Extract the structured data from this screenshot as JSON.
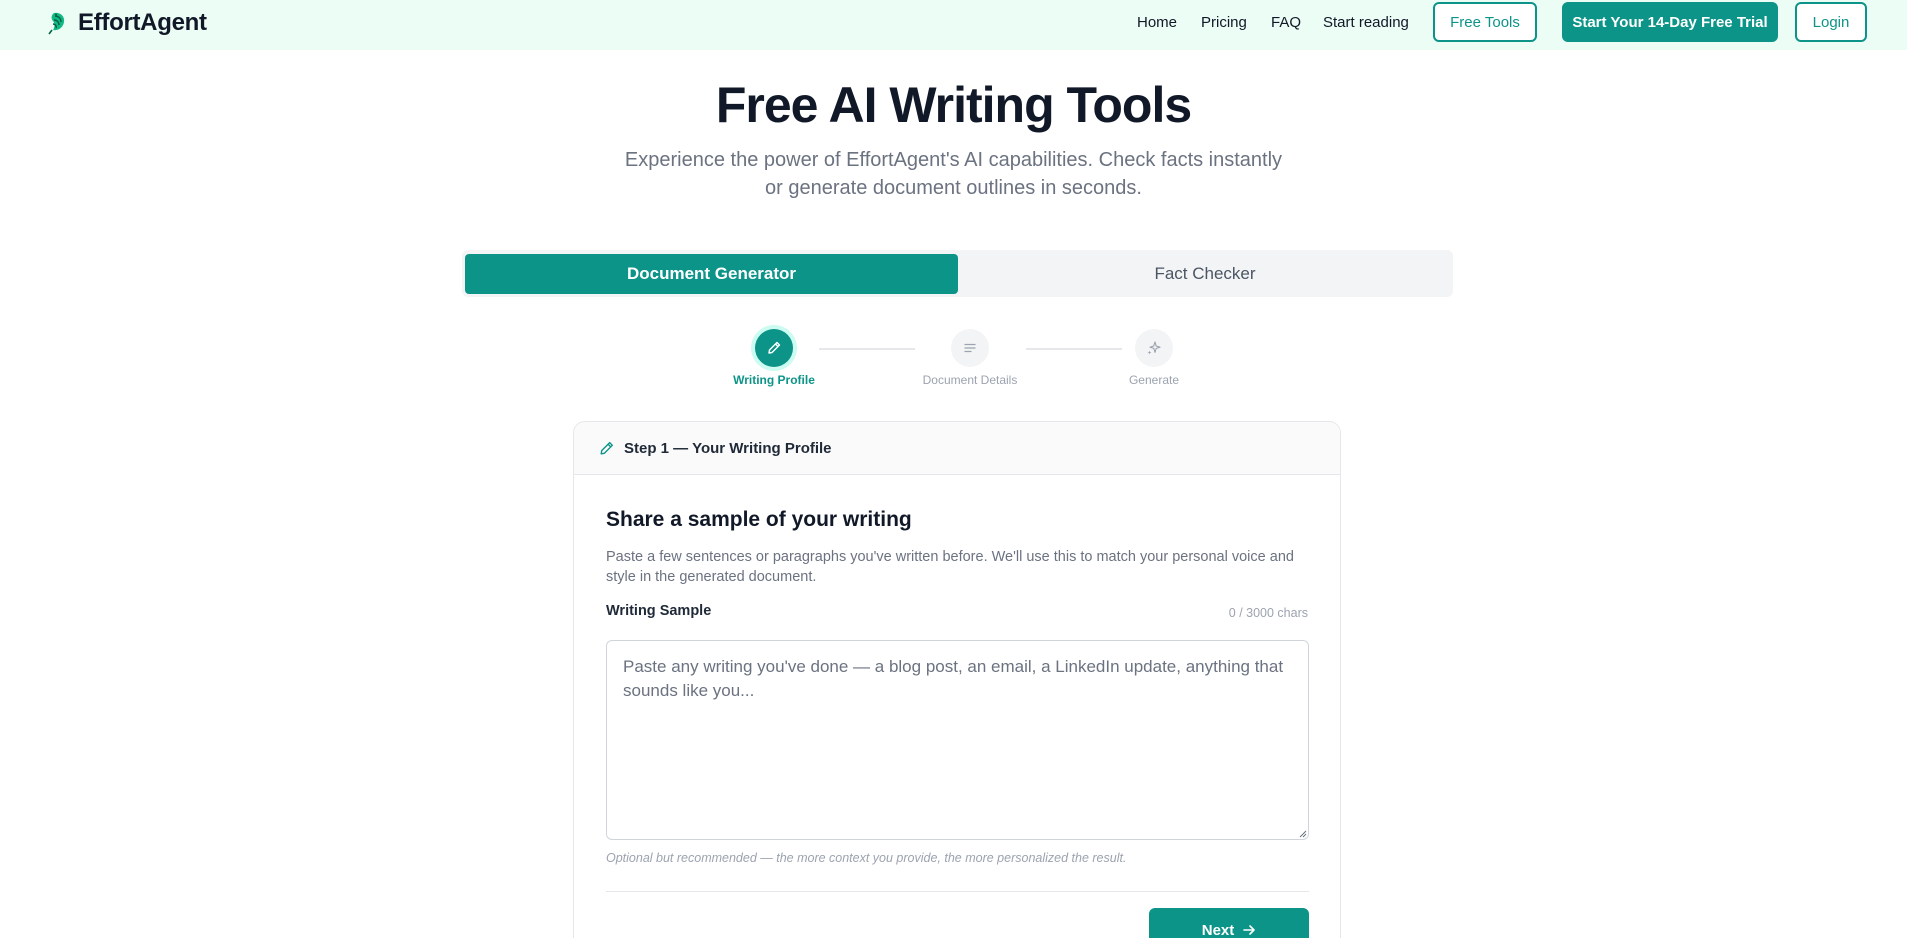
{
  "colors": {
    "accent": "#0d9488",
    "header_bg": "#ecfdf5",
    "muted": "#6b7280"
  },
  "header": {
    "brand": "EffortAgent",
    "logo_icon": "leaf-bird-icon",
    "nav": [
      "Home",
      "Pricing",
      "FAQ",
      "Start reading"
    ],
    "free_tools": "Free Tools",
    "trial": "Start Your 14-Day Free Trial",
    "login": "Login"
  },
  "hero": {
    "title": "Free AI Writing Tools",
    "subtitle": "Experience the power of EffortAgent's AI capabilities. Check facts instantly or generate document outlines in seconds."
  },
  "tabs": [
    {
      "label": "Document Generator",
      "active": true
    },
    {
      "label": "Fact Checker",
      "active": false
    }
  ],
  "steps": [
    {
      "label": "Writing Profile",
      "icon": "pencil-icon",
      "active": true
    },
    {
      "label": "Document Details",
      "icon": "lines-icon",
      "active": false
    },
    {
      "label": "Generate",
      "icon": "sparkles-icon",
      "active": false
    }
  ],
  "card": {
    "header": "Step 1 — Your Writing Profile",
    "title": "Share a sample of your writing",
    "description": "Paste a few sentences or paragraphs you've written before. We'll use this to match your personal voice and style in the generated document.",
    "field_label": "Writing Sample",
    "char_count": "0 / 3000 chars",
    "placeholder": "Paste any writing you've done — a blog post, an email, a LinkedIn update, anything that sounds like you...",
    "value": "",
    "hint": "Optional but recommended — the more context you provide, the more personalized the result.",
    "next": "Next"
  }
}
